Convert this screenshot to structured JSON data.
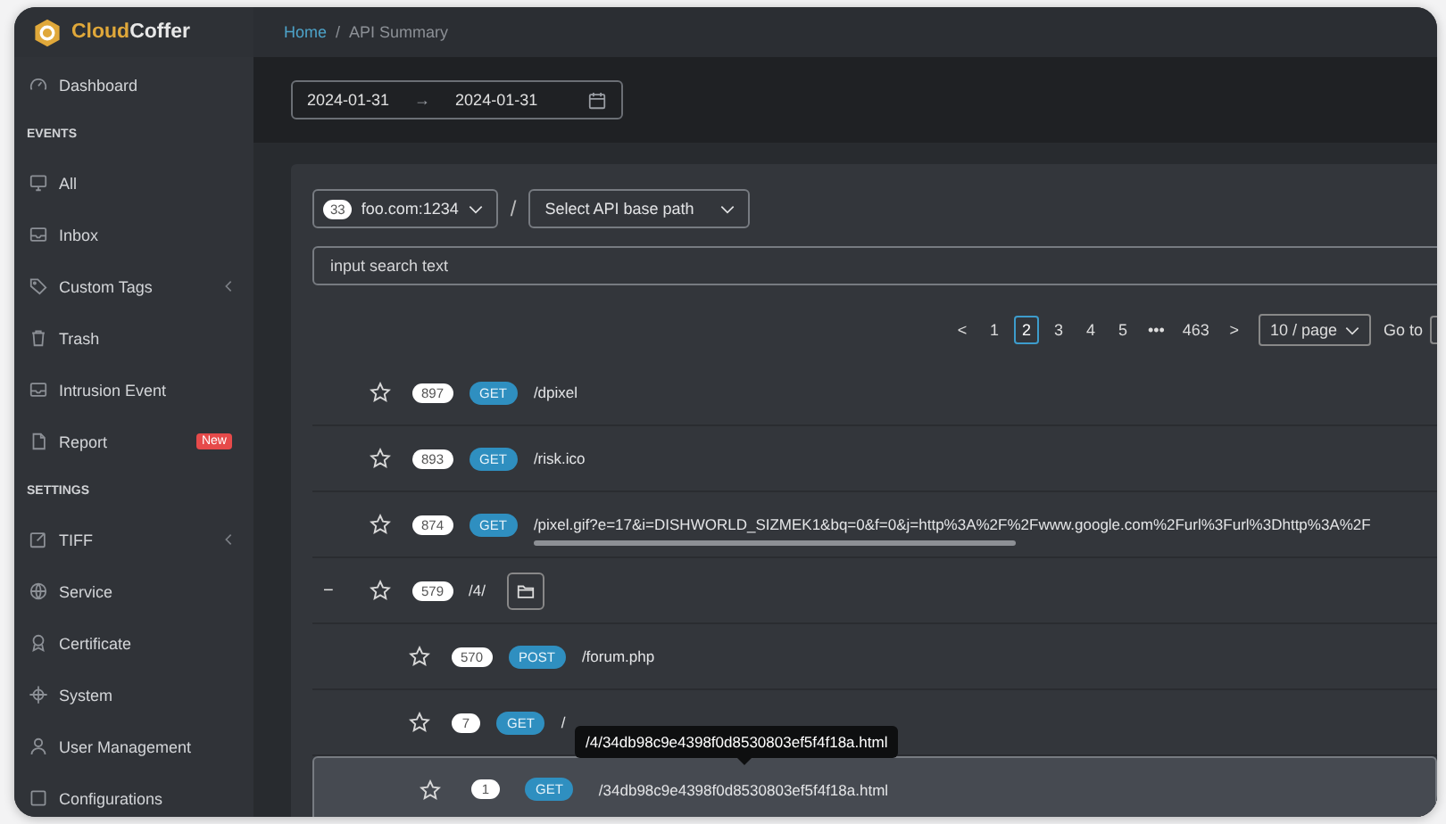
{
  "brand": {
    "name_a": "Cloud",
    "name_b": "Coffer"
  },
  "breadcrumb": [
    {
      "label": "Home",
      "link": true
    },
    {
      "label": "API Summary",
      "link": false
    }
  ],
  "breadcrumb_separator": "/",
  "sidebar": {
    "items": [
      {
        "kind": "item",
        "label": "Dashboard"
      },
      {
        "kind": "section",
        "label": "EVENTS"
      },
      {
        "kind": "item",
        "label": "All"
      },
      {
        "kind": "item",
        "label": "Inbox"
      },
      {
        "kind": "item",
        "label": "Custom Tags",
        "submenu": true
      },
      {
        "kind": "item",
        "label": "Trash"
      },
      {
        "kind": "item",
        "label": "Intrusion Event"
      },
      {
        "kind": "item",
        "label": "Report",
        "badge": "New"
      },
      {
        "kind": "section",
        "label": "SETTINGS"
      },
      {
        "kind": "item",
        "label": "TIFF",
        "submenu": true
      },
      {
        "kind": "item",
        "label": "Service"
      },
      {
        "kind": "item",
        "label": "Certificate"
      },
      {
        "kind": "item",
        "label": "System"
      },
      {
        "kind": "item",
        "label": "User Management"
      },
      {
        "kind": "item",
        "label": "Configurations"
      }
    ]
  },
  "date_range": {
    "start": "2024-01-31",
    "separator": "→",
    "end": "2024-01-31"
  },
  "host_select": {
    "count": "33",
    "value": "foo.com:1234"
  },
  "path_separator": "/",
  "base_path_select": {
    "placeholder": "Select API base path"
  },
  "search": {
    "placeholder": "input search text"
  },
  "pagination": {
    "prev": "<",
    "next": ">",
    "pages": [
      {
        "label": "1",
        "selected": false
      },
      {
        "label": "2",
        "selected": true
      },
      {
        "label": "3",
        "selected": false
      },
      {
        "label": "4",
        "selected": false
      },
      {
        "label": "5",
        "selected": false
      },
      {
        "label": "•••",
        "selected": false
      },
      {
        "label": "463",
        "selected": false
      }
    ],
    "page_size": "10 / page",
    "goto_label": "Go to"
  },
  "rows": [
    {
      "count": "897",
      "method": "GET",
      "path": "/dpixel",
      "selected": false
    },
    {
      "count": "893",
      "method": "GET",
      "path": "/risk.ico",
      "selected": false
    },
    {
      "count": "874",
      "method": "GET",
      "path": "/pixel.gif?e=17&i=DISHWORLD_SIZMEK1&bq=0&f=0&j=http%3A%2F%2Fwww.google.com%2Furl%3Furl%3Dhttp%3A%2F",
      "selected": false,
      "scrollbar": true
    },
    {
      "count": "579",
      "path": "/4/",
      "selected": false,
      "expanded": true,
      "toggle": "−",
      "children": [
        {
          "count": "570",
          "method": "POST",
          "path": "/forum.php",
          "selected": false
        },
        {
          "count": "7",
          "method": "GET",
          "path": "/",
          "selected": false
        },
        {
          "count": "1",
          "method": "GET",
          "path": "/34db98c9e4398f0d8530803ef5f4f18a.html",
          "selected": true,
          "tooltip": "/4/34db98c9e4398f0d8530803ef5f4f18a.html"
        }
      ]
    }
  ]
}
